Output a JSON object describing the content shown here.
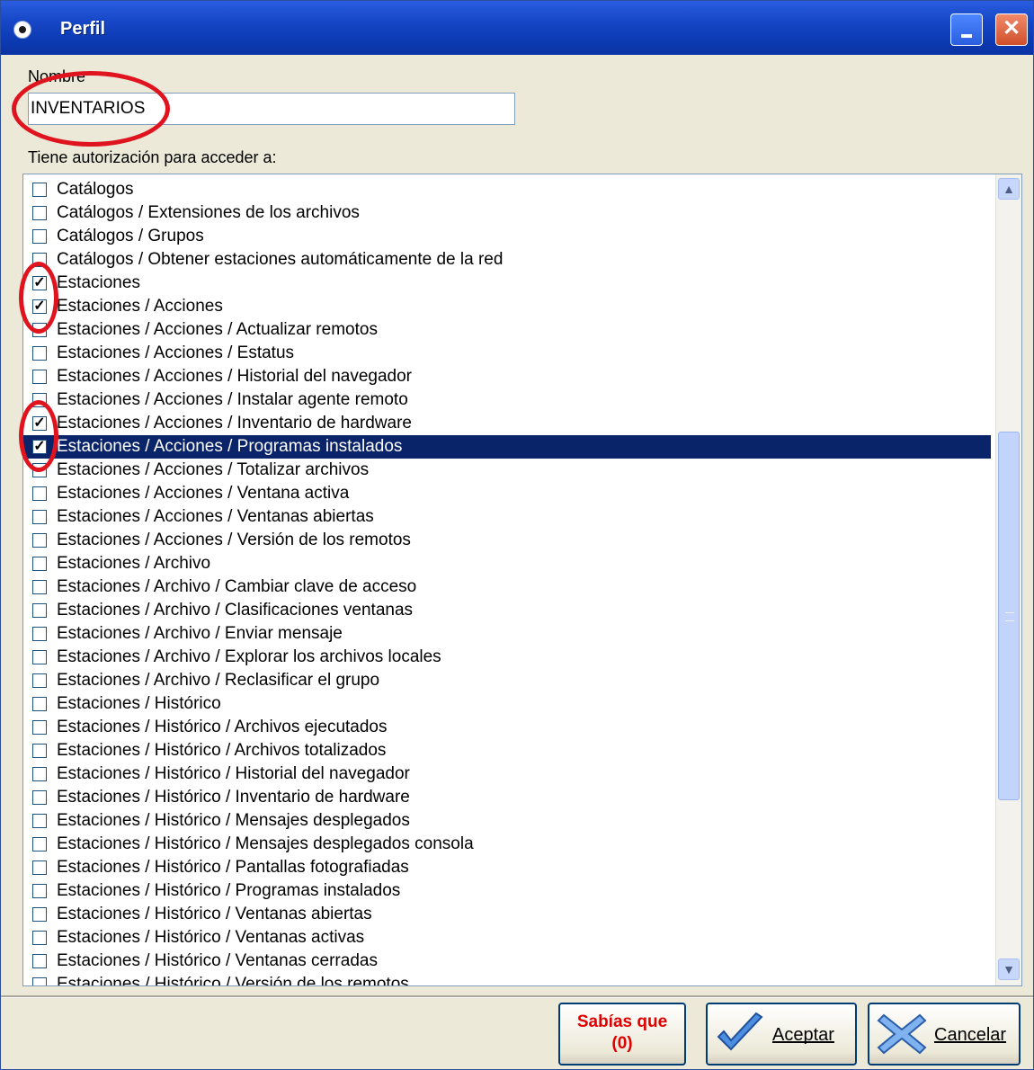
{
  "window": {
    "title": "Perfil",
    "close_glyph": "✕"
  },
  "form": {
    "name_label": "Nombre",
    "name_value": "INVENTARIOS",
    "permissions_label": "Tiene autorización para acceder a:"
  },
  "permissions": [
    {
      "label": "Catálogos",
      "checked": false
    },
    {
      "label": "Catálogos / Extensiones de los archivos",
      "checked": false
    },
    {
      "label": "Catálogos / Grupos",
      "checked": false
    },
    {
      "label": "Catálogos / Obtener estaciones automáticamente de la red",
      "checked": false
    },
    {
      "label": "Estaciones",
      "checked": true
    },
    {
      "label": "Estaciones / Acciones",
      "checked": true
    },
    {
      "label": "Estaciones / Acciones / Actualizar remotos",
      "checked": false
    },
    {
      "label": "Estaciones / Acciones / Estatus",
      "checked": false
    },
    {
      "label": "Estaciones / Acciones / Historial del navegador",
      "checked": false
    },
    {
      "label": "Estaciones / Acciones / Instalar agente remoto",
      "checked": false
    },
    {
      "label": "Estaciones / Acciones / Inventario de hardware",
      "checked": true
    },
    {
      "label": "Estaciones / Acciones / Programas instalados",
      "checked": true,
      "selected": true
    },
    {
      "label": "Estaciones / Acciones / Totalizar archivos",
      "checked": false
    },
    {
      "label": "Estaciones / Acciones / Ventana activa",
      "checked": false
    },
    {
      "label": "Estaciones / Acciones / Ventanas abiertas",
      "checked": false
    },
    {
      "label": "Estaciones / Acciones / Versión de los remotos",
      "checked": false
    },
    {
      "label": "Estaciones / Archivo",
      "checked": false
    },
    {
      "label": "Estaciones / Archivo / Cambiar clave de acceso",
      "checked": false
    },
    {
      "label": "Estaciones / Archivo / Clasificaciones ventanas",
      "checked": false
    },
    {
      "label": "Estaciones / Archivo / Enviar mensaje",
      "checked": false
    },
    {
      "label": "Estaciones / Archivo / Explorar los archivos locales",
      "checked": false
    },
    {
      "label": "Estaciones / Archivo / Reclasificar el grupo",
      "checked": false
    },
    {
      "label": "Estaciones / Histórico",
      "checked": false
    },
    {
      "label": "Estaciones / Histórico / Archivos ejecutados",
      "checked": false
    },
    {
      "label": "Estaciones / Histórico / Archivos totalizados",
      "checked": false
    },
    {
      "label": "Estaciones / Histórico / Historial del navegador",
      "checked": false
    },
    {
      "label": "Estaciones / Histórico / Inventario de hardware",
      "checked": false
    },
    {
      "label": "Estaciones / Histórico / Mensajes desplegados",
      "checked": false
    },
    {
      "label": "Estaciones / Histórico / Mensajes desplegados consola",
      "checked": false
    },
    {
      "label": "Estaciones / Histórico / Pantallas fotografiadas",
      "checked": false
    },
    {
      "label": "Estaciones / Histórico / Programas instalados",
      "checked": false
    },
    {
      "label": "Estaciones / Histórico / Ventanas abiertas",
      "checked": false
    },
    {
      "label": "Estaciones / Histórico / Ventanas activas",
      "checked": false
    },
    {
      "label": "Estaciones / Histórico / Ventanas cerradas",
      "checked": false
    },
    {
      "label": "Estaciones / Histórico / Versión de los remotos",
      "checked": false
    }
  ],
  "buttons": {
    "sabias_line1": "Sabías que",
    "sabias_line2": "(0)",
    "aceptar": "Aceptar",
    "cancelar": "Cancelar"
  },
  "colors": {
    "accent_red": "#e00000",
    "selection": "#0a246a",
    "titlebar": "#0d3bb5"
  }
}
